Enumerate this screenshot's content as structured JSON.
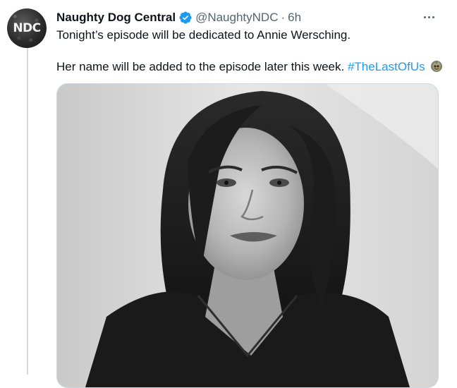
{
  "tweet": {
    "avatar_text": "NDC",
    "display_name": "Naughty Dog Central",
    "handle": "@NaughtyNDC",
    "separator": "·",
    "time": "6h",
    "line1": "Tonight’s episode will be dedicated to Annie Wersching.",
    "line2_text": "Her name will be added to the episode later this week.",
    "hashtag": "#TheLastOfUs",
    "icons": {
      "verified": "verified-badge-icon",
      "more": "more-options-icon",
      "hashtag_emoji": "the-last-of-us-hashflag-icon"
    },
    "colors": {
      "link": "#1d9bf0",
      "secondary_text": "#536471",
      "border": "#cfd9de"
    }
  }
}
